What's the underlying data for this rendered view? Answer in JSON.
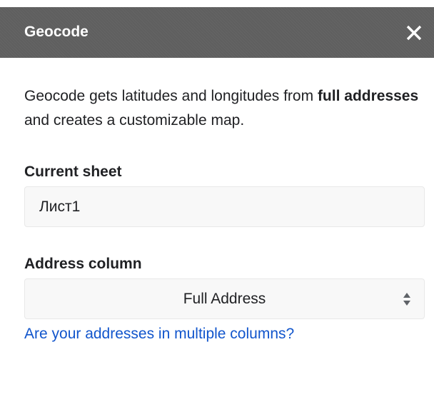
{
  "header": {
    "title": "Geocode",
    "close_icon": "close-icon"
  },
  "intro": {
    "text_before": "Geocode gets latitudes and longitudes from ",
    "bold_text": "full addresses",
    "text_after": " and creates a customizable map."
  },
  "current_sheet": {
    "label": "Current sheet",
    "value": "Лист1"
  },
  "address_column": {
    "label": "Address column",
    "selected": "Full Address",
    "arrow_icon": "select-arrows-icon"
  },
  "multi_column_link": {
    "text": "Are your addresses in multiple columns?"
  },
  "colors": {
    "header_bg": "#5f5f5f",
    "link": "#1155cc",
    "text": "#202124"
  }
}
